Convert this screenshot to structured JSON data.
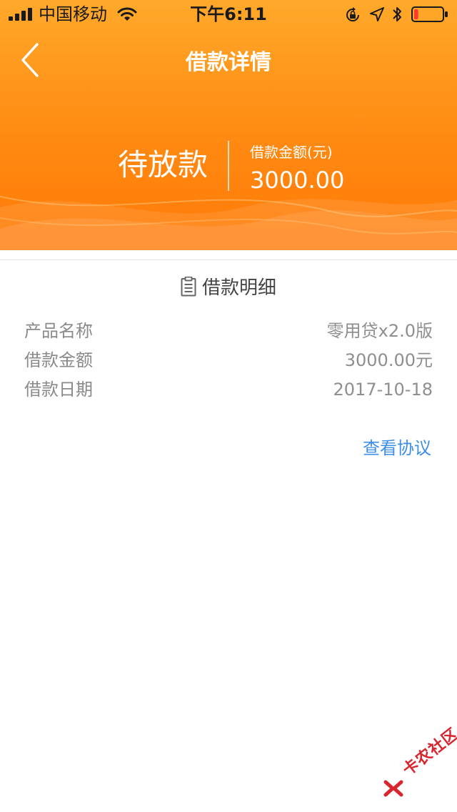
{
  "status_bar": {
    "carrier": "中国移动",
    "time": "下午6:11",
    "icons": [
      "signal-icon",
      "wifi-icon",
      "rotation-lock-icon",
      "location-icon",
      "bluetooth-icon",
      "battery-icon"
    ],
    "battery_color": "#ff3b30",
    "battery_level": 0.15
  },
  "nav": {
    "title": "借款详情",
    "back_icon": "chevron-left-icon"
  },
  "summary": {
    "status": "待放款",
    "amount_label": "借款金额(元)",
    "amount_value": "3000.00"
  },
  "details": {
    "section_title": "借款明细",
    "section_icon": "document-icon",
    "rows": [
      {
        "label": "产品名称",
        "value": "零用贷x2.0版"
      },
      {
        "label": "借款金额",
        "value": "3000.00元"
      },
      {
        "label": "借款日期",
        "value": "2017-10-18"
      }
    ],
    "link": "查看协议"
  },
  "watermark": {
    "text": "卡农社区"
  },
  "colors": {
    "header_top": "#ffa92a",
    "header_bottom": "#ff7a08",
    "link": "#3d8ee6",
    "label_text": "#8a8a8a"
  }
}
